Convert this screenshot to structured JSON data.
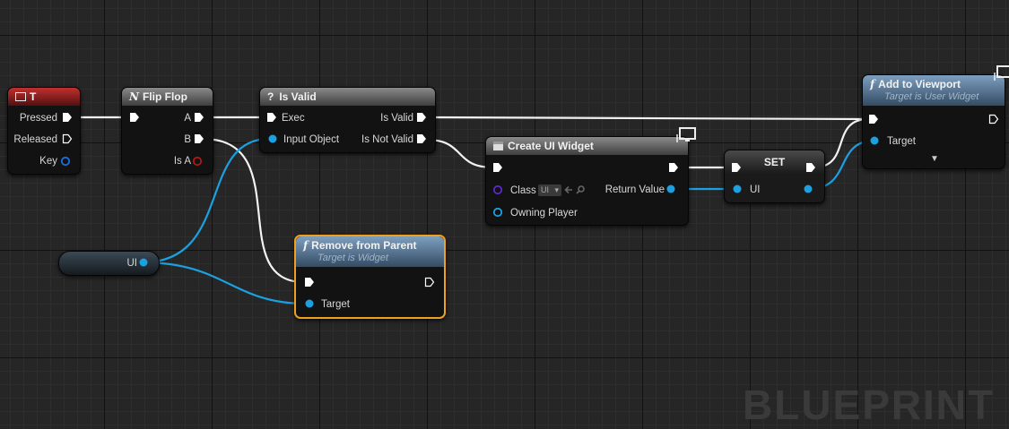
{
  "nodes": {
    "key_event": {
      "title": "T",
      "pressed": "Pressed",
      "released": "Released",
      "key": "Key"
    },
    "flip_flop": {
      "title": "Flip Flop",
      "a": "A",
      "b": "B",
      "is_a": "Is A"
    },
    "is_valid": {
      "title": "Is Valid",
      "exec": "Exec",
      "input_object": "Input Object",
      "is_valid": "Is Valid",
      "is_not_valid": "Is Not Valid"
    },
    "create_widget": {
      "title": "Create UI Widget",
      "class": "Class",
      "class_value": "UI",
      "return_value": "Return Value",
      "owning_player": "Owning Player"
    },
    "set": {
      "title": "SET",
      "ui": "UI"
    },
    "add_to_viewport": {
      "title": "Add to Viewport",
      "subtitle": "Target is User Widget",
      "target": "Target"
    },
    "ui_var": {
      "label": "UI"
    },
    "remove_from_parent": {
      "title": "Remove from Parent",
      "subtitle": "Target is Widget",
      "target": "Target"
    }
  },
  "colors": {
    "exec_wire": "#ffffff",
    "object_wire": "#1ba0e0",
    "event_header": "#a82424",
    "function_header": "#5a7a99",
    "selected_outline": "#f0a020",
    "class_pin": "#5a2acc",
    "bool_pin": "#b01818"
  },
  "watermark": "BLUEPRINT"
}
